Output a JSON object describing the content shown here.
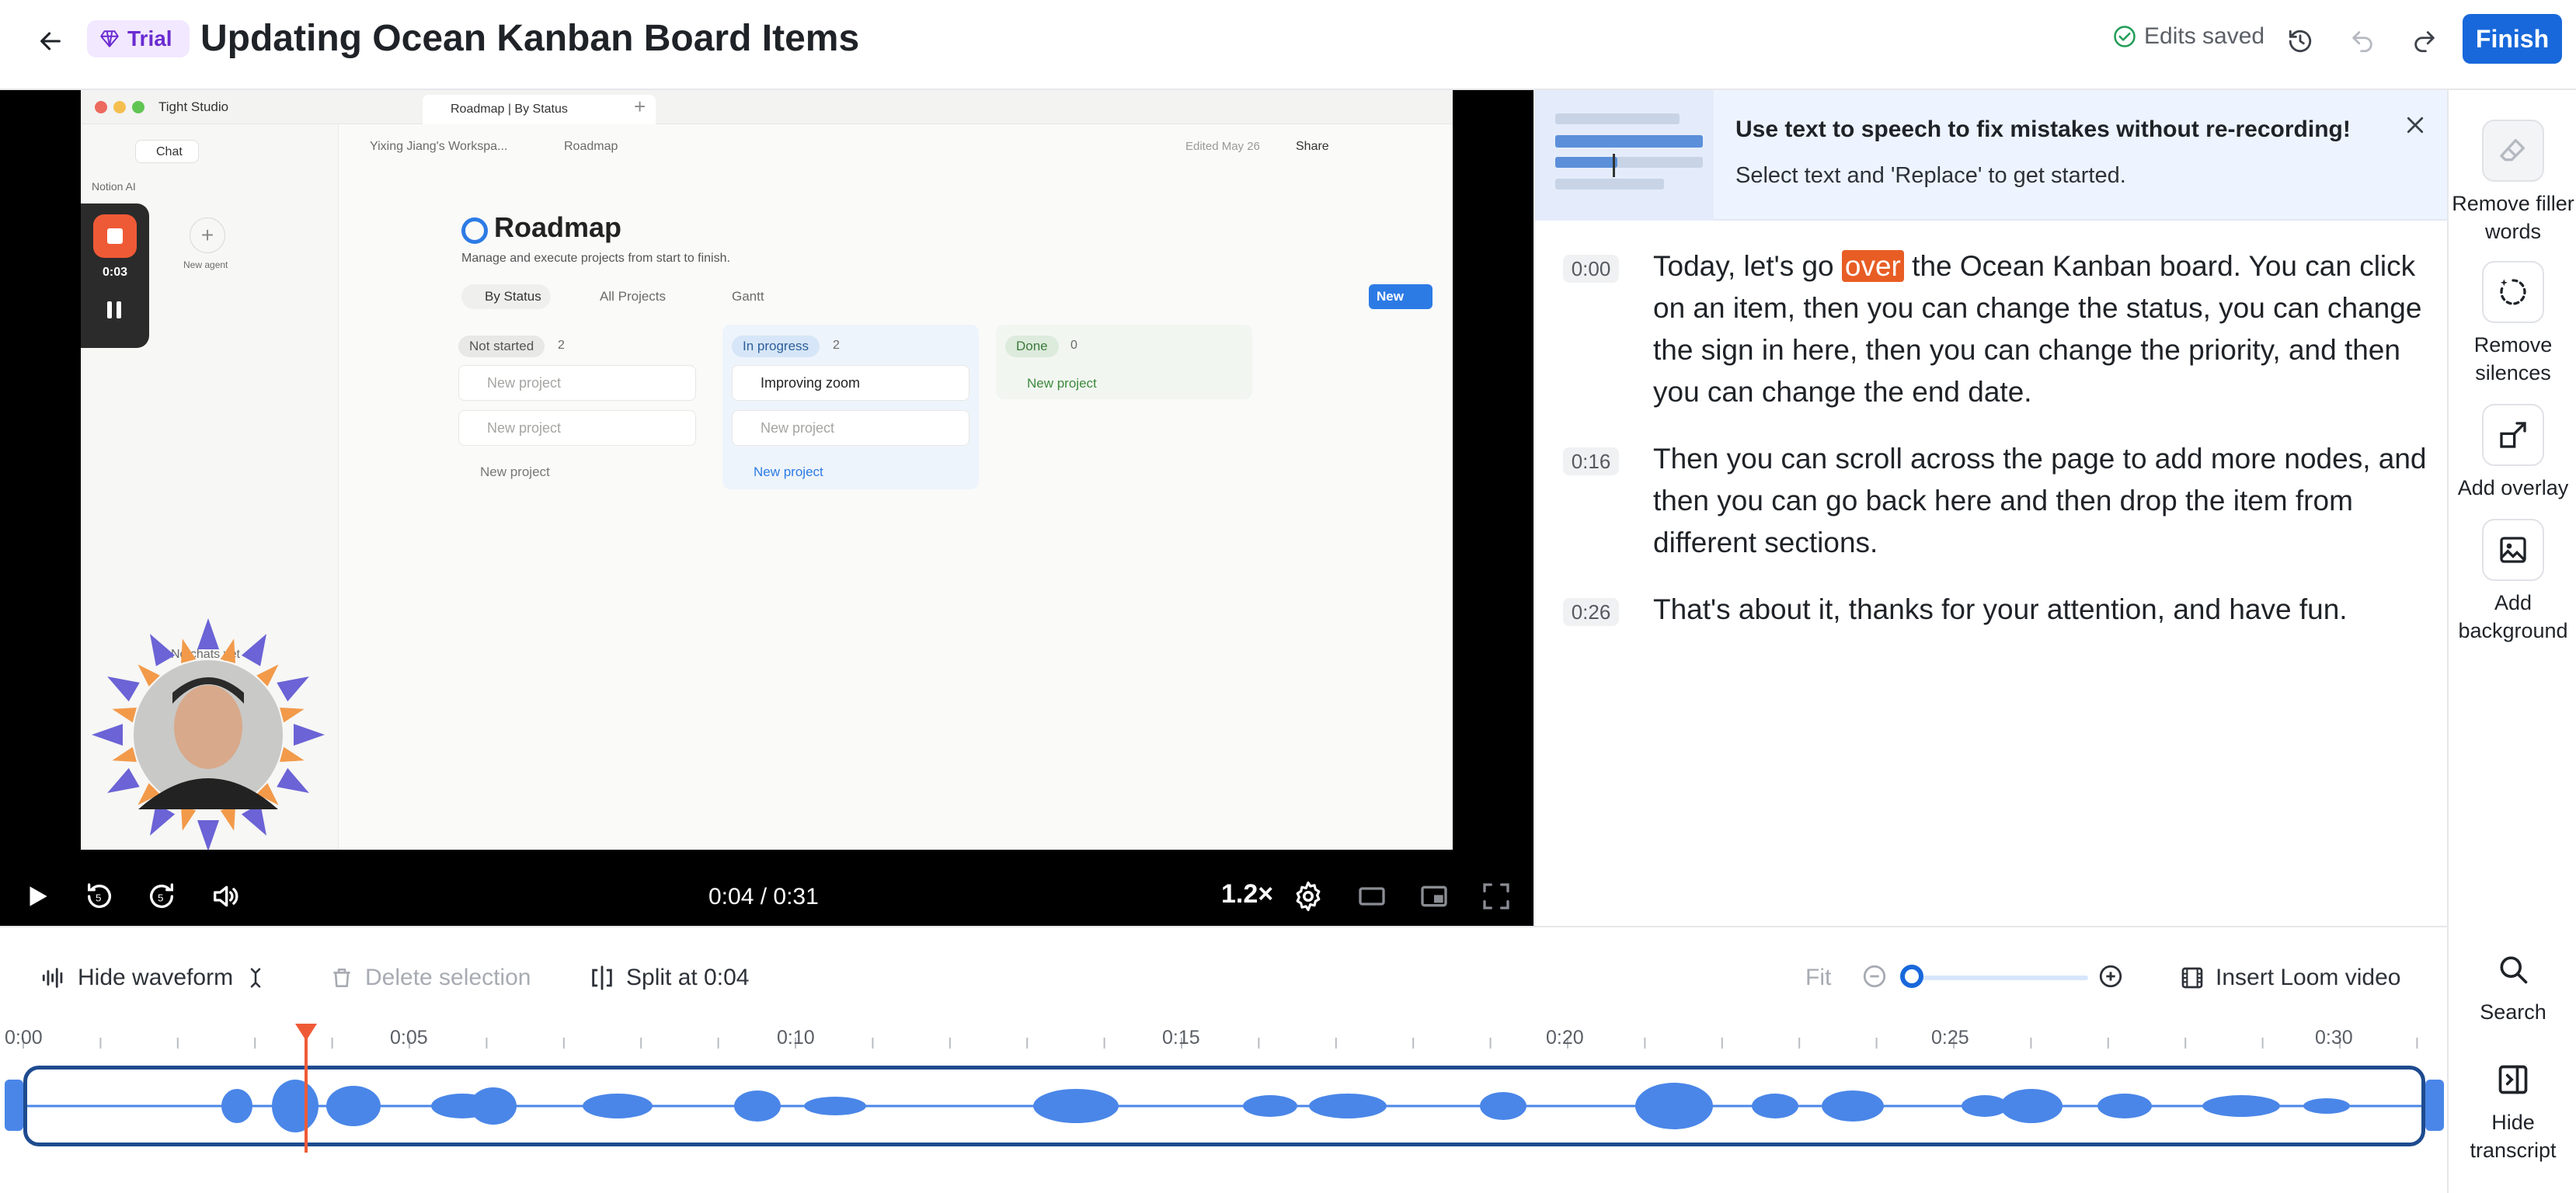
{
  "header": {
    "trial_label": "Trial",
    "title": "Updating Ocean Kanban Board Items",
    "edits_status": "Edits saved",
    "finish_label": "Finish"
  },
  "video": {
    "time": "0:04 / 0:31",
    "speed": "1.2×",
    "screen": {
      "workspace": "Tight Studio",
      "tab_title": "Roadmap | By Status",
      "chat_label": "Chat",
      "notion_ai": "Notion AI",
      "rec_time": "0:03",
      "new_agent": "New agent",
      "no_chats": "No chats yet",
      "breadcrumb_workspace": "Yixing Jiang's Workspa...",
      "breadcrumb_page": "Roadmap",
      "edited": "Edited May 26",
      "share": "Share",
      "page_title": "Roadmap",
      "page_desc": "Manage and execute projects from start to finish.",
      "views": [
        "By Status",
        "All Projects",
        "Gantt"
      ],
      "new_btn": "New",
      "columns": [
        {
          "name": "Not started",
          "count": "2",
          "cards": [
            "New project",
            "New project"
          ],
          "add": "New project"
        },
        {
          "name": "In progress",
          "count": "2",
          "cards": [
            "Improving zoom",
            "New project"
          ],
          "add": "New project"
        },
        {
          "name": "Done",
          "count": "0",
          "cards": [],
          "add": "New project"
        }
      ]
    }
  },
  "banner": {
    "title": "Use text to speech to fix mistakes without re-recording!",
    "subtitle": "Select text and 'Replace' to get started."
  },
  "transcript": [
    {
      "time": "0:00",
      "before": "Today, let's go ",
      "highlight": "over",
      "after": " the Ocean Kanban board. You can click on an item, then you can change the status, you can change the sign in here, then you can change the priority, and then you can change the end date."
    },
    {
      "time": "0:16",
      "before": "Then you can scroll across the page to add more nodes, and then you can go back here and then drop the item from different sections.",
      "highlight": "",
      "after": ""
    },
    {
      "time": "0:26",
      "before": "That's about it, thanks for your attention, and have fun.",
      "highlight": "",
      "after": ""
    }
  ],
  "rail": {
    "remove_filler": "Remove filler words",
    "remove_silences": "Remove silences",
    "add_overlay": "Add overlay",
    "add_background": "Add background",
    "search": "Search",
    "hide_transcript": "Hide transcript"
  },
  "timeline": {
    "hide_waveform": "Hide waveform",
    "delete_selection": "Delete selection",
    "split": "Split at 0:04",
    "fit": "Fit",
    "insert_loom": "Insert Loom video",
    "ruler_labels": [
      "0:00",
      "0:05",
      "0:10",
      "0:15",
      "0:20",
      "0:25",
      "0:30"
    ],
    "zoom_level": 0
  },
  "colors": {
    "accent": "#1868db",
    "highlight": "#e85d24",
    "waveform": "#4a86e8",
    "playhead": "#ef5a36"
  }
}
